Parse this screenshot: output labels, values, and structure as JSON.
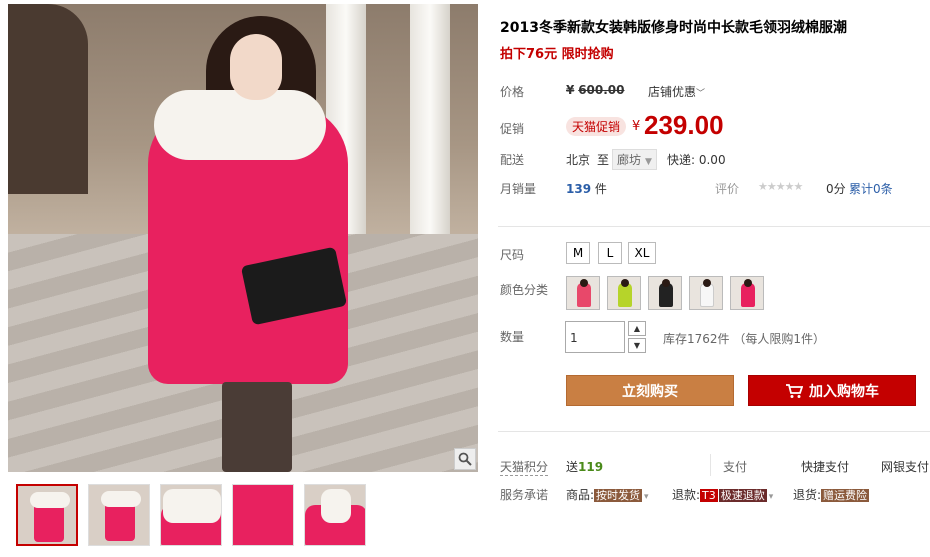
{
  "product": {
    "title": "2013冬季新款女装韩版修身时尚中长款毛领羽绒棉服潮",
    "subtitle": "拍下76元 限时抢购"
  },
  "price": {
    "label": "价格",
    "currency": "¥",
    "original": "600.00",
    "shop_promo": "店铺优惠",
    "promo_label": "促销",
    "promo_badge": "天猫促销",
    "current": "239.00"
  },
  "shipping": {
    "label": "配送",
    "from": "北京",
    "to": "至",
    "city": "廊坊",
    "express": "快递: 0.00"
  },
  "sales": {
    "label": "月销量",
    "count": "139",
    "unit": "件",
    "rating_label": "评价",
    "stars": "★★★★★",
    "rating_score": "0分",
    "rating_total": "累计0条"
  },
  "size": {
    "label": "尺码",
    "options": [
      "M",
      "L",
      "XL"
    ]
  },
  "color": {
    "label": "颜色分类",
    "swatches": [
      {
        "icon": "pink-coat-swatch",
        "color": "#e8486a"
      },
      {
        "icon": "yellow-green-coat-swatch",
        "color": "#b6d42a"
      },
      {
        "icon": "black-coat-swatch",
        "color": "#222222"
      },
      {
        "icon": "white-coat-swatch",
        "color": "#f2f2f2"
      },
      {
        "icon": "rose-coat-swatch",
        "color": "#e8215f"
      }
    ]
  },
  "quantity": {
    "label": "数量",
    "value": "1",
    "stock": "库存1762件 （每人限购1件）"
  },
  "actions": {
    "buy_now": "立刻购买",
    "add_to_cart": "加入购物车"
  },
  "points": {
    "label": "天猫积分",
    "prefix": "送",
    "value": "119"
  },
  "payment": {
    "label": "支付",
    "quick": "快捷支付",
    "bank": "网银支付"
  },
  "service": {
    "label": "服务承诺",
    "goods_prefix": "商品:",
    "goods_tag": "按时发货",
    "refund_prefix": "退款:",
    "refund_t3": "T3",
    "refund_tag": "极速退款",
    "return_prefix": "退货:",
    "return_tag": "赠运费险"
  },
  "colors": {
    "accent_red": "#c40000",
    "buy_button": "#c97f43",
    "link_blue": "#2b5ea8"
  }
}
